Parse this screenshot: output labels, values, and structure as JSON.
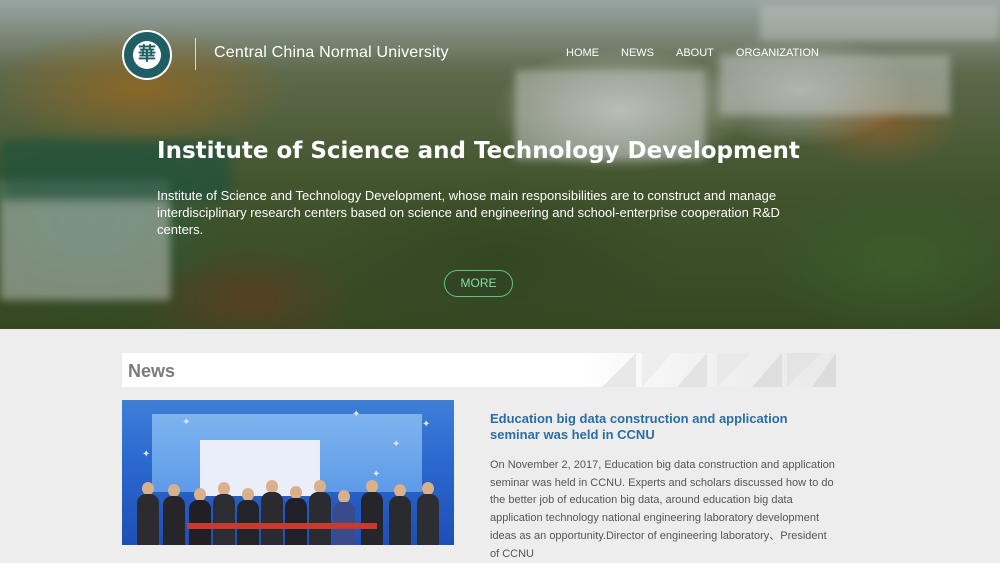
{
  "header": {
    "brand_name": "Central China Normal University",
    "logo_glyph": "華",
    "nav": [
      {
        "label": "HOME"
      },
      {
        "label": "NEWS"
      },
      {
        "label": "ABOUT"
      },
      {
        "label": "ORGANIZATION"
      }
    ]
  },
  "hero": {
    "title": "Institute of Science and Technology Development",
    "description": "Institute of Science and Technology Development, whose main responsibilities are to construct and manage interdisciplinary research centers based on science and engineering and school-enterprise cooperation R&D centers.",
    "more_label": "MORE"
  },
  "news": {
    "section_title": "News",
    "article": {
      "title": "Education big data construction and application seminar was held in CCNU",
      "body": "On November 2, 2017, Education big data construction and application seminar was held in CCNU. Experts and scholars discussed how to do the better job of education big data, around education big data application technology national engineering laboratory development ideas as an opportunity.Director of engineering laboratory、President of CCNU"
    }
  },
  "colors": {
    "accent_green": "#63c08d",
    "article_title_blue": "#2a6ea6",
    "logo_teal": "#1f5e63"
  }
}
